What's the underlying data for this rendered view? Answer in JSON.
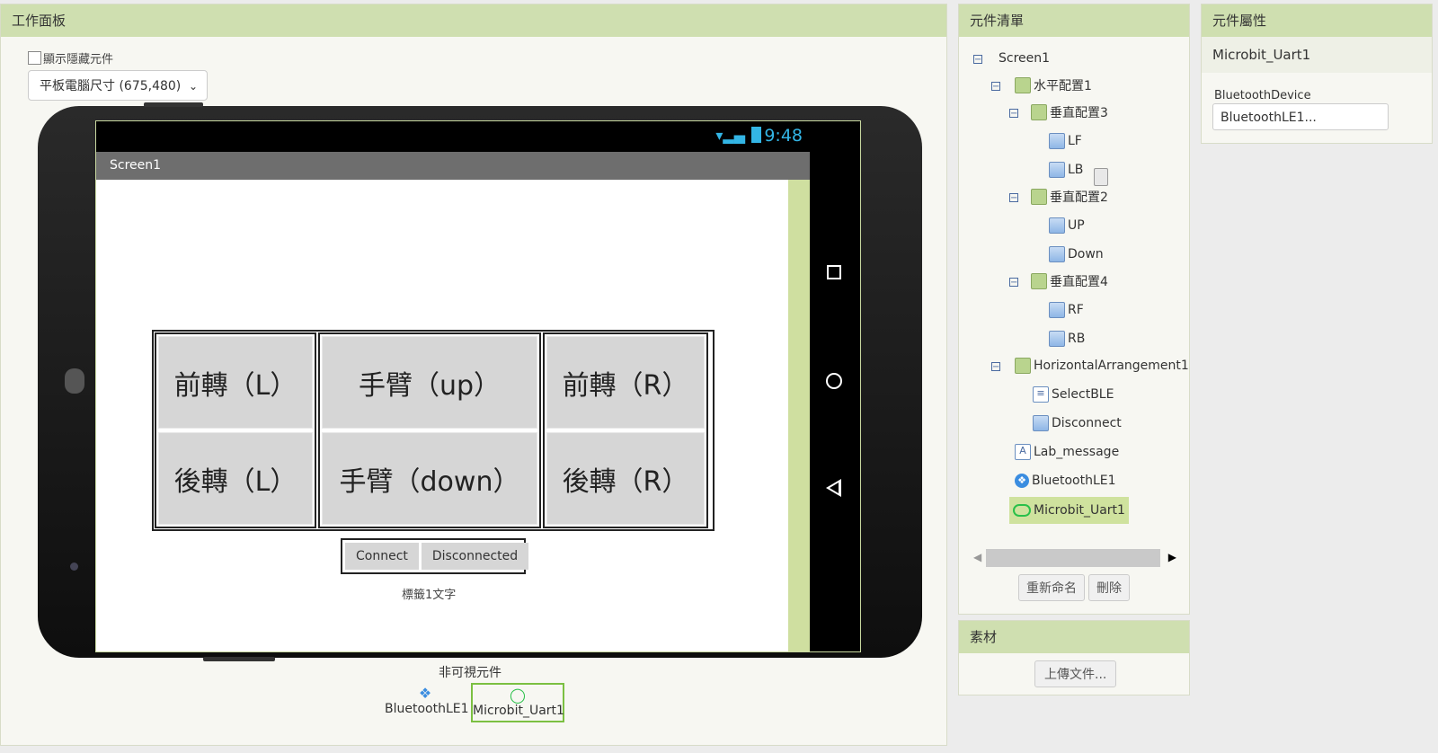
{
  "viewer": {
    "header": "工作面板",
    "show_hidden_label": "顯示隱藏元件",
    "size_select_value": "平板電腦尺寸 (675,480)",
    "status_time": "9:48",
    "screen_title": "Screen1",
    "buttons": {
      "lf": "前轉（L）",
      "lb": "後轉（L）",
      "up": "手臂（up）",
      "down": "手臂（down）",
      "rf": "前轉（R）",
      "rb": "後轉（R）"
    },
    "connect_label": "Connect",
    "disconnect_label": "Disconnected",
    "label_text": "標籤1文字",
    "nonvisible_title": "非可視元件",
    "nonvisible": [
      "BluetoothLE1",
      "Microbit_Uart1"
    ]
  },
  "components": {
    "header": "元件清單",
    "tree": {
      "screen": "Screen1",
      "ha1": "水平配置1",
      "va3": "垂直配置3",
      "lf": "LF",
      "lb": "LB",
      "va2": "垂直配置2",
      "up": "UP",
      "down": "Down",
      "va4": "垂直配置4",
      "rf": "RF",
      "rb": "RB",
      "ha_eng": "HorizontalArrangement1",
      "selectble": "SelectBLE",
      "disconnect": "Disconnect",
      "lab": "Lab_message",
      "ble": "BluetoothLE1",
      "mb": "Microbit_Uart1"
    },
    "rename_button": "重新命名",
    "delete_button": "刪除"
  },
  "media": {
    "header": "素材",
    "upload_button": "上傳文件..."
  },
  "properties": {
    "header": "元件屬性",
    "component_name": "Microbit_Uart1",
    "prop_label": "BluetoothDevice",
    "prop_value": "BluetoothLE1..."
  }
}
